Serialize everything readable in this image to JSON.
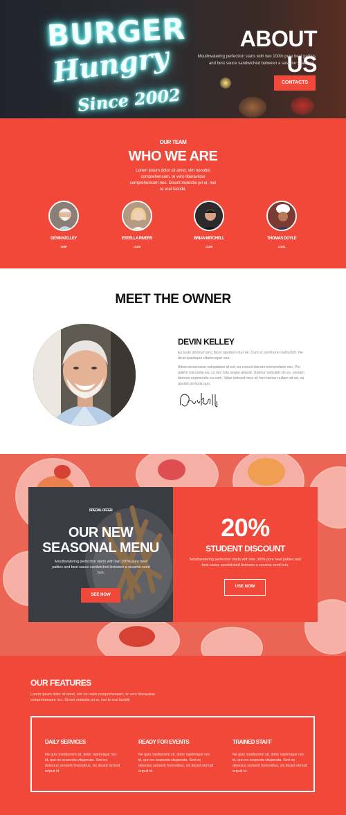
{
  "colors": {
    "accent": "#f2483a",
    "dark": "#20232c",
    "white": "#ffffff"
  },
  "hero": {
    "neon_sign_text": [
      "BURGER",
      "Hungry",
      "Since 2002"
    ],
    "title": "ABOUT US",
    "subtitle": "Mouthwatering perfection starts with two 100% pure beef patties and best sauce sandwiched between a sesame seed bun.",
    "cta_label": "CONTACTS"
  },
  "team": {
    "eyebrow": "OUR TEAM",
    "title": "WHO WE ARE",
    "description": "Lorem ipsum dolor sit amet, vim nonobis comprehensam, te vero liberavisse comprehensam nec. Dicunt molestie pri ei, mei te erat fastidii.",
    "members": [
      {
        "name": "DEVIN KELLEY",
        "role": "CHEF"
      },
      {
        "name": "ESTELLA RIVERS",
        "role": "COOK"
      },
      {
        "name": "BRIAN MITCHELL",
        "role": "COOK"
      },
      {
        "name": "THOMAS DOYLE",
        "role": "COOK"
      }
    ]
  },
  "owner": {
    "section_title": "MEET THE OWNER",
    "name": "DEVIN KELLEY",
    "paragraph1": "Eu iusto dolorum pro, facer oportere duo ne. Cum ei commune instructior. Ne dicat qualisque ullamcorper sea.",
    "paragraph2": "Altera deseruisse voluptatum id est, eu consul discere interpretaris nec. Per autem iracundia ea, cu nec tota seque aliquid. Utamur iudicabit vix ex, veniam labores expetendis ea eam. Vitae detraxit mea id; fem tantas nullam sit ad, ea quodsi pericula quo.",
    "signature_icon": "signature-icon"
  },
  "offer": {
    "special_label": "SPECIAL OFFER",
    "menu_title_line1": "OUR NEW",
    "menu_title_line2": "SEASONAL MENU",
    "menu_description": "Mouthwatering perfection starts with two 100% pure beef patties and best sauce sandwiched between a sesame seed bun.",
    "menu_cta": "SEE NOW",
    "discount_value": "20%",
    "discount_title": "STUDENT DISCOUNT",
    "discount_description": "Mouthwatering perfection starts with two 100% pure beef patties and best sauce sandwiched between a sesame seed bun.",
    "discount_cta": "USE NOW"
  },
  "features": {
    "title": "OUR FEATURES",
    "description": "Lorem ipsum dolor sit amet, vim no nobis comprehensam, te vero liberavisse comprehensam nec. Dicunt molestie pri ei, mei te erat fastidii.",
    "items": [
      {
        "title": "DAILY SERVICES",
        "text": "Ne quis mediocrem sit, dolor reprimique nec id, quo no scaevola vituperata. Sed ea delectus senserit forensibus, vis dicant eirmod eripuit id."
      },
      {
        "title": "READY FOR EVENTS",
        "text": "Ne quis mediocrem sit, dolor reprimique nec id, quo no scaevola vituperata. Sed ea delectus senserit forensibus, vis dicant eirmod eripuit id."
      },
      {
        "title": "TRAINED STAFF",
        "text": "Ne quis mediocrem sit, dolor reprimique nec id, quo no scaevola vituperata. Sed ea delectus senserit forensibus, vis dicant eirmod eripuit id."
      }
    ]
  }
}
